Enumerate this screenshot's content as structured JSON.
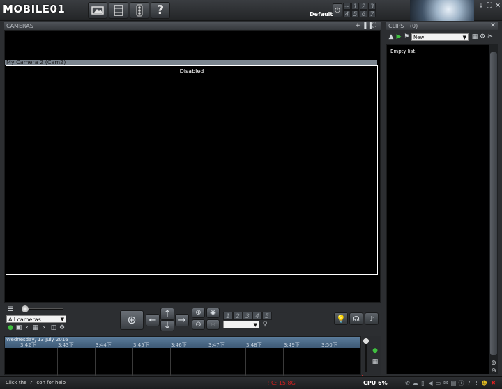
{
  "app": {
    "logo_text": "MOBILE01",
    "profile_label": "Default",
    "workspace_numbers": [
      "~",
      "1",
      "2",
      "3",
      "4",
      "5",
      "6",
      "7"
    ]
  },
  "toolbar": {
    "icons": [
      "video-icon",
      "image-icon",
      "film-icon",
      "traffic-light-icon",
      "help-icon"
    ],
    "help_glyph": "?"
  },
  "cameras": {
    "header_title": "CAMERAS",
    "camera_name": "My Camera 2 (Cam2)",
    "status": "Disabled"
  },
  "controls": {
    "camera_select": "All cameras",
    "presets": [
      "1",
      "2",
      "3",
      "4",
      "5"
    ]
  },
  "timeline": {
    "date": "Wednesday, 13 July 2016",
    "ticks": [
      "3:42下",
      "3:43下",
      "3:44下",
      "3:45下",
      "3:46下",
      "3:47下",
      "3:48下",
      "3:49下",
      "3:50下"
    ]
  },
  "clips": {
    "header_title": "CLIPS",
    "count": "(0)",
    "filter_select": "New",
    "empty_text": "Empty list."
  },
  "status": {
    "help_text": "Click the '?' icon for help",
    "temperature": "!! C: 15.8G",
    "cpu": "CPU 6%"
  },
  "colors": {
    "accent_blue": "#4d6d8d",
    "status_red": "#d02020",
    "timeline_marker": "#c0302c"
  }
}
